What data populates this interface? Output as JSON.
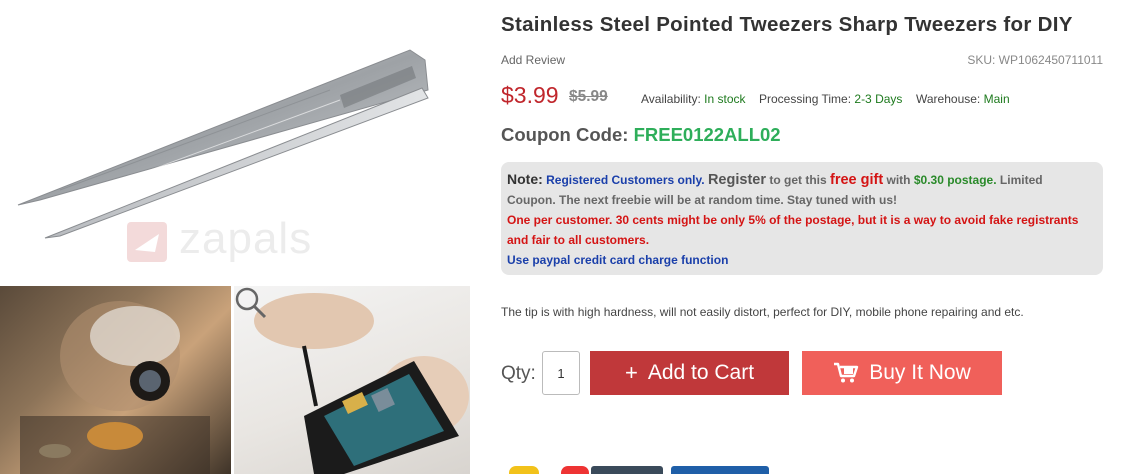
{
  "gallery": {
    "watermark": "zapals",
    "images": [
      {
        "name": "main-product-image",
        "alt": "Stainless steel pointed tweezers"
      },
      {
        "name": "watchmaker-thumbnail"
      },
      {
        "name": "phone-repair-thumbnail"
      }
    ]
  },
  "product": {
    "title": "Stainless Steel Pointed Tweezers Sharp Tweezers for DIY",
    "add_review": "Add Review",
    "sku": "SKU: WP1062450711011",
    "price": "$3.99",
    "old_price": "$5.99",
    "availability_label": "Availability:",
    "availability_value": "In stock",
    "processing_label": "Processing Time:",
    "processing_value": "2-3 Days",
    "warehouse_label": "Warehouse:",
    "warehouse_value": "Main",
    "coupon_label": "Coupon Code:",
    "coupon_code": "FREE0122ALL02",
    "description": "The tip is with high hardness, will not easily distort, perfect for DIY, mobile phone repairing and etc."
  },
  "note": {
    "label": "Note:",
    "registered": "Registered Customers only.",
    "register": "Register",
    "to_get": "to get this",
    "free_gift": "free gift",
    "with": "with",
    "postage": "$0.30 postage.",
    "limited": "Limited",
    "line2": "Coupon. The next freebie will be at random time. Stay tuned with us!",
    "line3": "One per customer. 30 cents might be only 5% of the postage, but it is a way to avoid fake registrants",
    "line4": "and fair to all customers.",
    "line5": "Use paypal credit card charge function"
  },
  "purchase": {
    "qty_label": "Qty:",
    "qty_value": "1",
    "add_to_cart_icon": "+",
    "add_to_cart": "Add to Cart",
    "buy_now": "Buy It Now",
    "buy_now_icon": "cart-icon"
  },
  "colors": {
    "price": "#c0262c",
    "coupon_code": "#2eae5a",
    "add_to_cart_bg": "#c0383a",
    "buy_now_bg": "#f0605a",
    "note_bg": "#e6e6e6"
  }
}
